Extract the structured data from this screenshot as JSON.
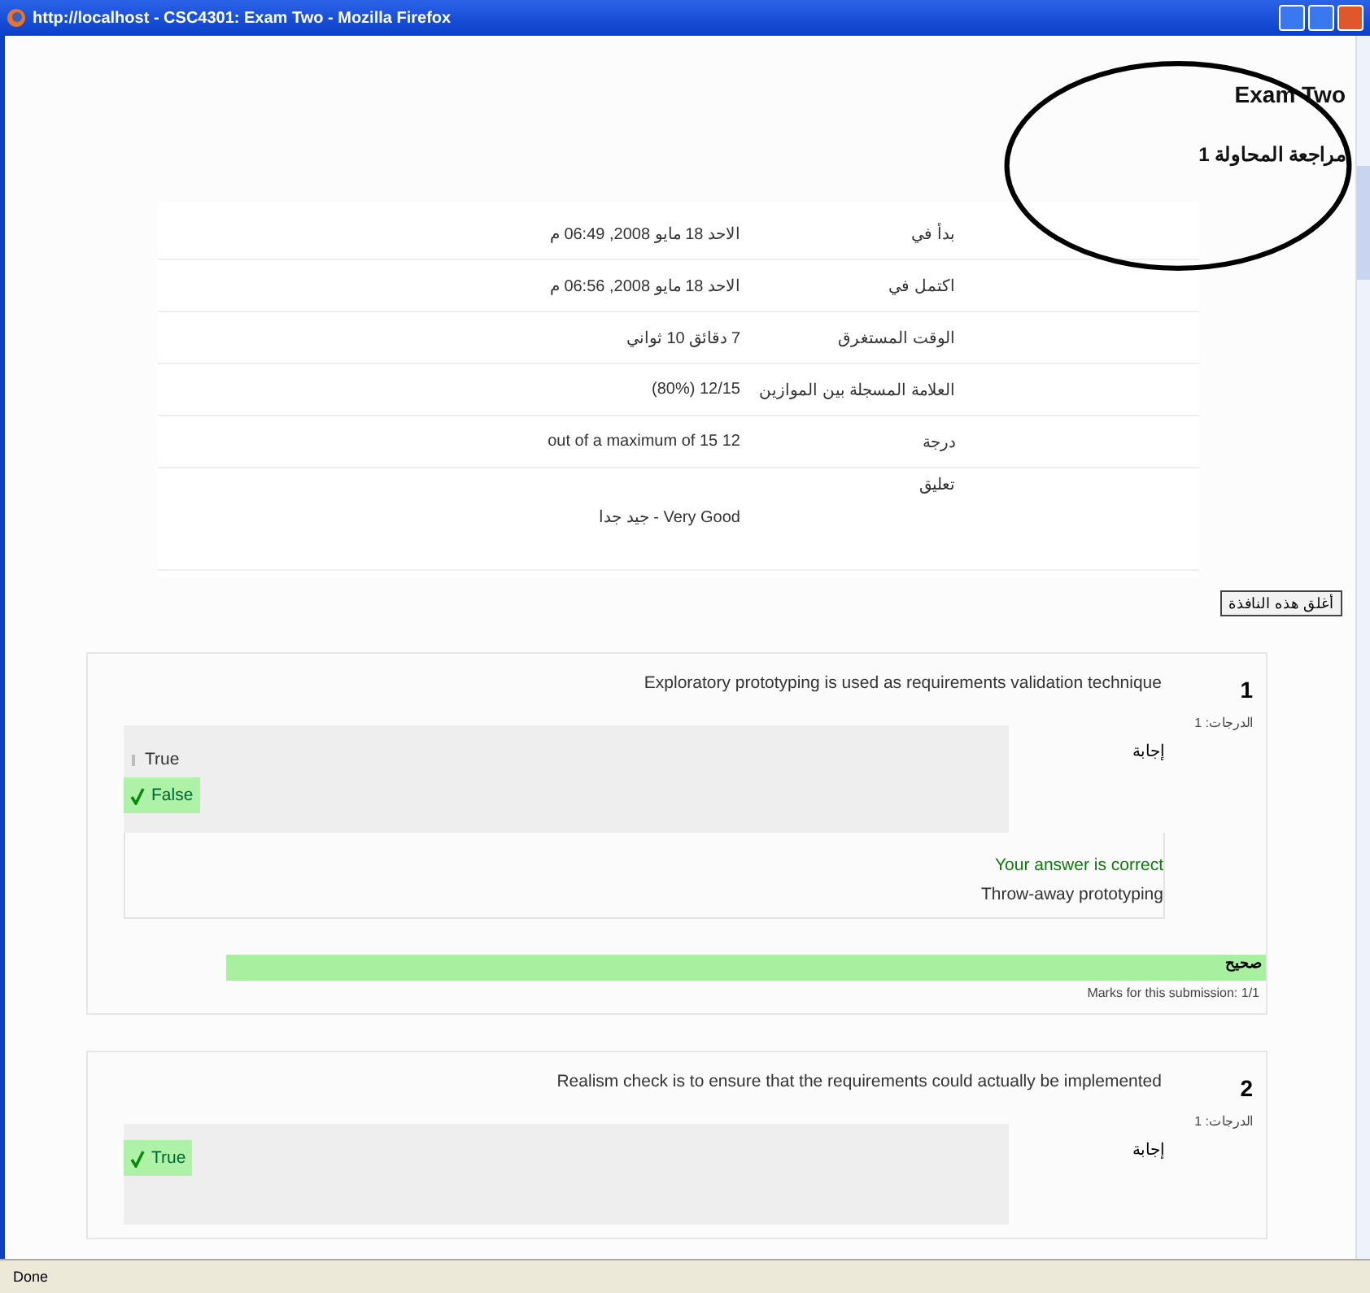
{
  "window": {
    "title": "http://localhost - CSC4301: Exam Two - Mozilla Firefox"
  },
  "heading": {
    "title": "Exam Two",
    "subtitle": "مراجعة المحاولة 1"
  },
  "summary": [
    {
      "label": "بدأ في",
      "value": "الاحد 18 مايو 2008, 06:49 م"
    },
    {
      "label": "اكتمل في",
      "value": "الاحد 18 مايو 2008, 06:56 م"
    },
    {
      "label": "الوقت المستغرق",
      "value": "7 دقائق 10 ثواني"
    },
    {
      "label": "العلامة المسجلة بين الموازين",
      "value": "12/15 (80%)"
    },
    {
      "label": "درجة",
      "value": "12 out of a maximum of 15"
    },
    {
      "label": "تعليق",
      "value": "Very Good - جيد جدا",
      "kind": "feedback"
    }
  ],
  "close_button": "أغلق هذه النافذة",
  "questions": [
    {
      "number": "1",
      "marks": "الدرجات: 1",
      "text": "Exploratory prototyping is used as requirements validation technique",
      "answer_label": "إجابة",
      "options": [
        {
          "label": "True",
          "selected": false
        },
        {
          "label": "False",
          "selected": true
        }
      ],
      "feedback": "Your answer is correct",
      "explanation": "Throw-away prototyping",
      "result": "صحيح",
      "submission_marks": "Marks for this submission: 1/1"
    },
    {
      "number": "2",
      "marks": "الدرجات: 1",
      "text": "Realism check is to ensure that the requirements could actually be implemented",
      "answer_label": "إجابة",
      "options": [
        {
          "label": "True",
          "selected": true
        }
      ]
    }
  ],
  "status_bar": "Done"
}
